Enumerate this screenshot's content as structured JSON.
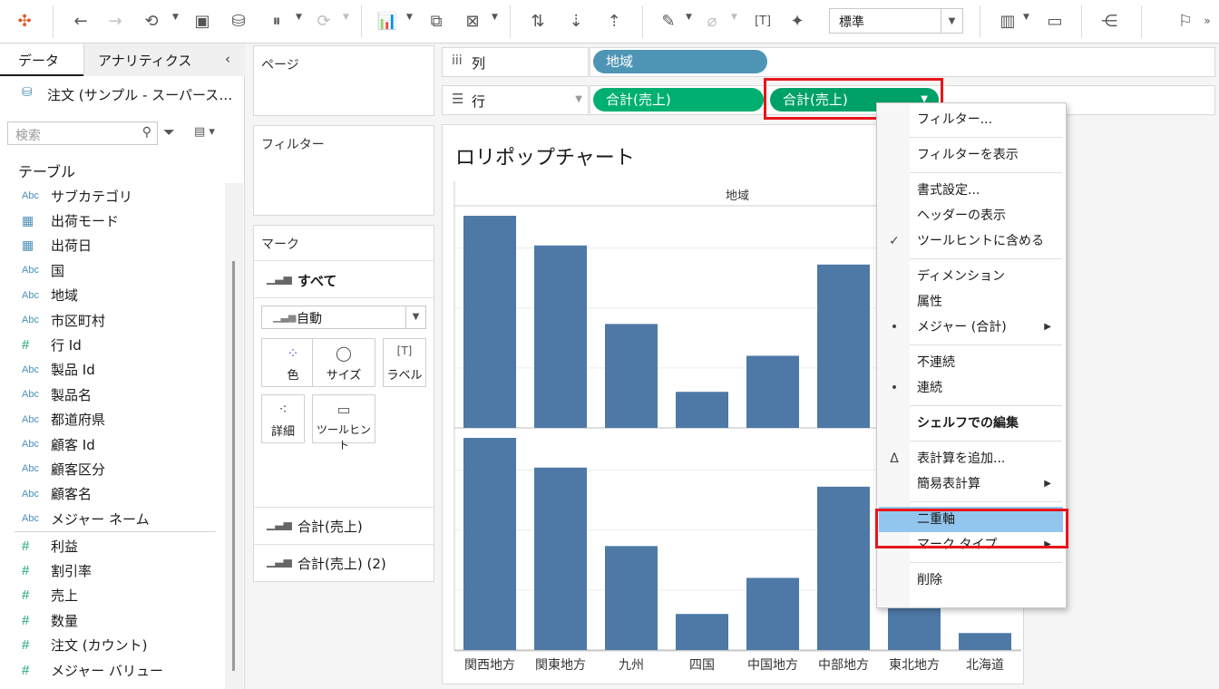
{
  "toolbar": {
    "zoom_value": "標準",
    "icons": [
      "tableau-logo-icon",
      "undo-icon",
      "redo-icon",
      "replay-icon",
      "save-icon",
      "new-datasource-icon",
      "pause-updates-icon",
      "refresh-icon",
      "new-worksheet-icon",
      "duplicate-sheet-icon",
      "clear-sheet-icon",
      "swap-rows-columns-icon",
      "sort-ascending-icon",
      "sort-descending-icon",
      "highlight-icon",
      "group-icon",
      "show-labels-icon",
      "pin-icon",
      "show-me-icon",
      "presentation-icon",
      "share-icon",
      "signpost-icon"
    ]
  },
  "data_pane": {
    "tabs": [
      "データ",
      "アナリティクス"
    ],
    "datasource": "注文 (サンプル - スーパース…",
    "search_placeholder": "検索",
    "section": "テーブル",
    "dimensions": [
      {
        "type": "Abc",
        "name": "サブカテゴリ"
      },
      {
        "type": "date",
        "name": "出荷モード"
      },
      {
        "type": "date",
        "name": "出荷日"
      },
      {
        "type": "Abc",
        "name": "国"
      },
      {
        "type": "Abc",
        "name": "地域"
      },
      {
        "type": "Abc",
        "name": "市区町村"
      },
      {
        "type": "#",
        "name": "行 Id"
      },
      {
        "type": "Abc",
        "name": "製品 Id"
      },
      {
        "type": "Abc",
        "name": "製品名"
      },
      {
        "type": "Abc",
        "name": "都道府県"
      },
      {
        "type": "Abc",
        "name": "顧客 Id"
      },
      {
        "type": "Abc",
        "name": "顧客区分"
      },
      {
        "type": "Abc",
        "name": "顧客名"
      },
      {
        "type": "Abc",
        "name": "メジャー ネーム"
      }
    ],
    "measures": [
      {
        "type": "#",
        "name": "利益"
      },
      {
        "type": "#",
        "name": "割引率"
      },
      {
        "type": "#",
        "name": "売上"
      },
      {
        "type": "#",
        "name": "数量"
      },
      {
        "type": "#",
        "name": "注文 (カウント)"
      },
      {
        "type": "#",
        "name": "メジャー バリュー"
      }
    ]
  },
  "shelves": {
    "pages": "ページ",
    "filters": "フィルター",
    "marks": "マーク",
    "marks_all": "すべて",
    "mark_type": "自動",
    "mark_buttons": [
      "色",
      "サイズ",
      "ラベル",
      "詳細",
      "ツールヒント"
    ],
    "mark_measures": [
      "合計(売上)",
      "合計(売上) (2)"
    ],
    "columns_label": "列",
    "rows_label": "行",
    "columns_pill": "地域",
    "rows_pills": [
      "合計(売上)",
      "合計(売上)"
    ]
  },
  "chart_data": {
    "type": "bar",
    "title": "ロリポップチャート",
    "header": "地域",
    "categories": [
      "関西地方",
      "関東地方",
      "九州",
      "四国",
      "中国地方",
      "中部地方",
      "東北地方",
      "北海道"
    ],
    "series": [
      {
        "values": [
          1.0,
          0.86,
          0.49,
          0.17,
          0.34,
          0.77,
          0.24,
          0.08
        ]
      },
      {
        "values": [
          1.0,
          0.86,
          0.49,
          0.17,
          0.34,
          0.77,
          0.24,
          0.08
        ]
      }
    ],
    "bar_color": "#4e79a7"
  },
  "context_menu": {
    "items": [
      {
        "label": "フィルター...",
        "mark": ""
      },
      {
        "sep": true
      },
      {
        "label": "フィルターを表示",
        "mark": ""
      },
      {
        "sep": true
      },
      {
        "label": "書式設定...",
        "mark": ""
      },
      {
        "label": "ヘッダーの表示",
        "mark": ""
      },
      {
        "label": "ツールヒントに含める",
        "mark": "check"
      },
      {
        "sep": true
      },
      {
        "label": "ディメンション",
        "mark": ""
      },
      {
        "label": "属性",
        "mark": ""
      },
      {
        "label": "メジャー (合計)",
        "mark": "dot",
        "sub": true
      },
      {
        "sep": true
      },
      {
        "label": "不連続",
        "mark": ""
      },
      {
        "label": "連続",
        "mark": "dot"
      },
      {
        "sep": true
      },
      {
        "label": "シェルフでの編集",
        "mark": "",
        "bold": true
      },
      {
        "sep": true
      },
      {
        "label": "表計算を追加...",
        "mark": "delta"
      },
      {
        "label": "簡易表計算",
        "mark": "",
        "sub": true
      },
      {
        "sep": true
      },
      {
        "label": "二重軸",
        "mark": "",
        "highlight": true
      },
      {
        "label": "マーク タイプ",
        "mark": "",
        "sub": true
      },
      {
        "sep": true
      },
      {
        "label": "削除",
        "mark": ""
      }
    ]
  }
}
